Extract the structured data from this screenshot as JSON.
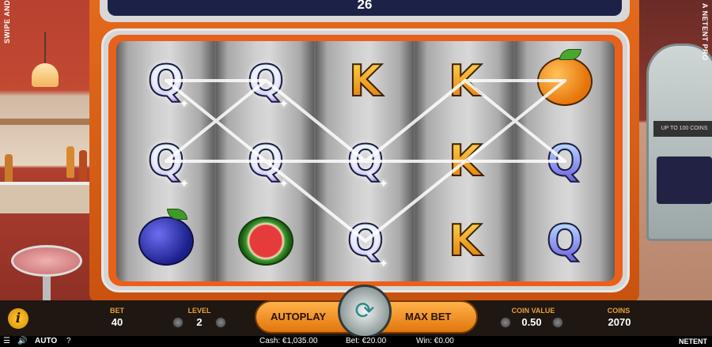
{
  "top_counter": "26",
  "side_left_text": "SWIPE AND",
  "side_right_text": "A NETENT PRO",
  "reels": [
    [
      "Q",
      "Q",
      "plum"
    ],
    [
      "Q",
      "Q",
      "watermelon"
    ],
    [
      "K",
      "Q",
      "Q"
    ],
    [
      "K",
      "K",
      "K"
    ],
    [
      "orange",
      "Q",
      "Q"
    ]
  ],
  "controls": {
    "bet_label": "BET",
    "bet_value": "40",
    "level_label": "LEVEL",
    "level_value": "2",
    "autoplay_label": "AUTOPLAY",
    "max_bet_label": "MAX BET",
    "coin_value_label": "COIN VALUE",
    "coin_value": "0.50",
    "coins_label": "COINS",
    "coins_value": "2070",
    "info_icon": "i"
  },
  "status": {
    "auto_label": "AUTO",
    "help_icon": "?",
    "cash": "Cash: €1,035.00",
    "bet": "Bet: €20.00",
    "win": "Win: €0.00",
    "brand": "NETENT"
  },
  "colors": {
    "cabinet": "#e36a1c",
    "accent": "#e8a13a",
    "win_line": "#ffffff"
  }
}
